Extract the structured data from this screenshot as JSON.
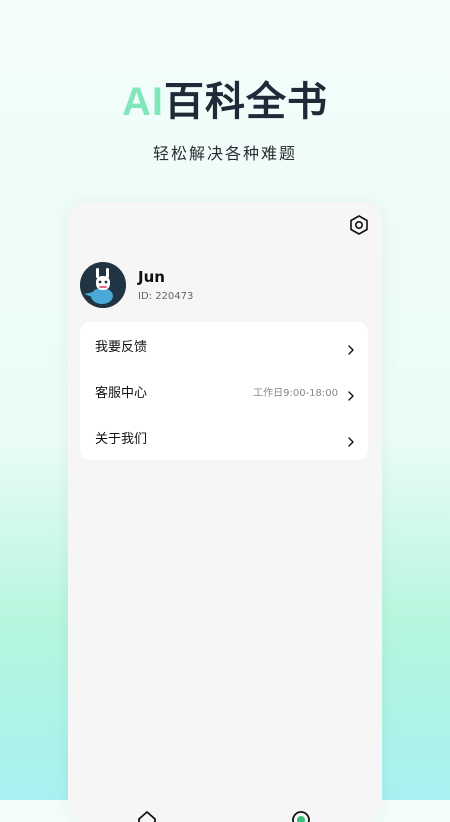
{
  "hero": {
    "title_ai": "AI",
    "title_rest": "百科全书",
    "subtitle": "轻松解决各种难题"
  },
  "profile": {
    "name": "Jun",
    "id_text": "ID: 220473"
  },
  "menu": {
    "feedback": "我要反馈",
    "customer_service": "客服中心",
    "customer_service_hours": "工作日9:00-18:00",
    "about": "关于我们"
  },
  "icons": {
    "settings": "settings-icon",
    "chevron": "chevron-right-icon",
    "home": "home-icon",
    "profile": "profile-icon"
  },
  "colors": {
    "accent_ai": "#7fe7b9",
    "title_text": "#1f2937",
    "avatar_bg": "#203443",
    "bottom_icon_active": "#3bbf7a"
  }
}
